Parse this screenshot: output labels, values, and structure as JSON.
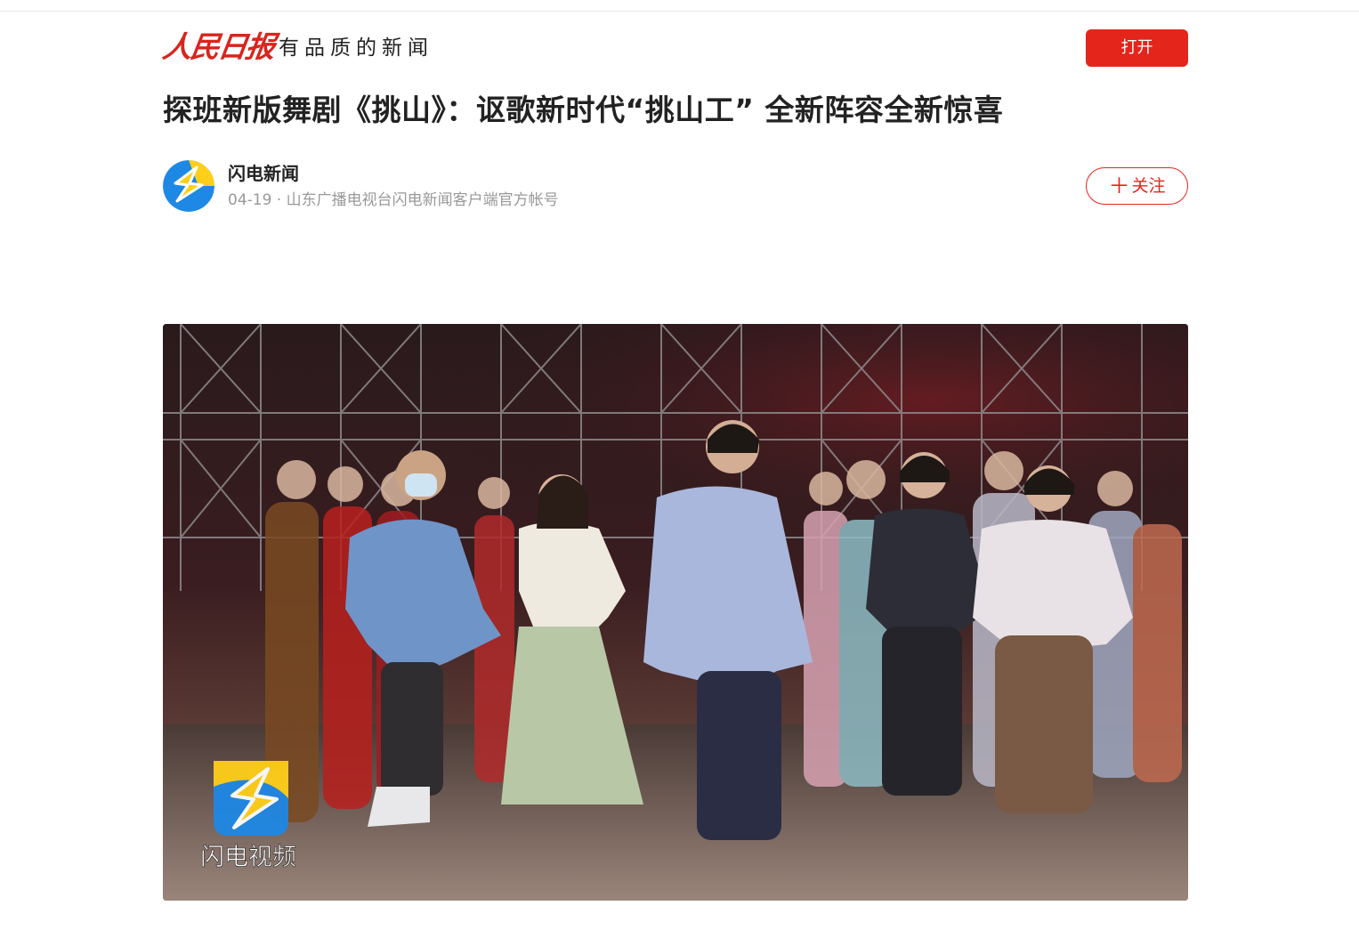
{
  "header": {
    "logo_text": "人民日报",
    "slogan": "有品质的新闻",
    "open_button": "打开"
  },
  "article": {
    "title": "探班新版舞剧《挑山》：讴歌新时代“挑山工” 全新阵容全新惊喜"
  },
  "author": {
    "name": "闪电新闻",
    "meta": "04-19 · 山东广播电视台闪电新闻客户端官方帐号",
    "follow_button": "关注"
  },
  "media": {
    "watermark_text": "闪电视频"
  },
  "colors": {
    "brand_red": "#e4251c",
    "logo_red": "#d6261e",
    "title_text": "#222222",
    "meta_text": "#999999",
    "flash_blue": "#1e88e5",
    "flash_yellow": "#ffcf1a"
  },
  "icons": {
    "avatar": "lightning-bolt-logo",
    "follow": "plus-icon",
    "watermark": "lightning-bolt-logo"
  }
}
